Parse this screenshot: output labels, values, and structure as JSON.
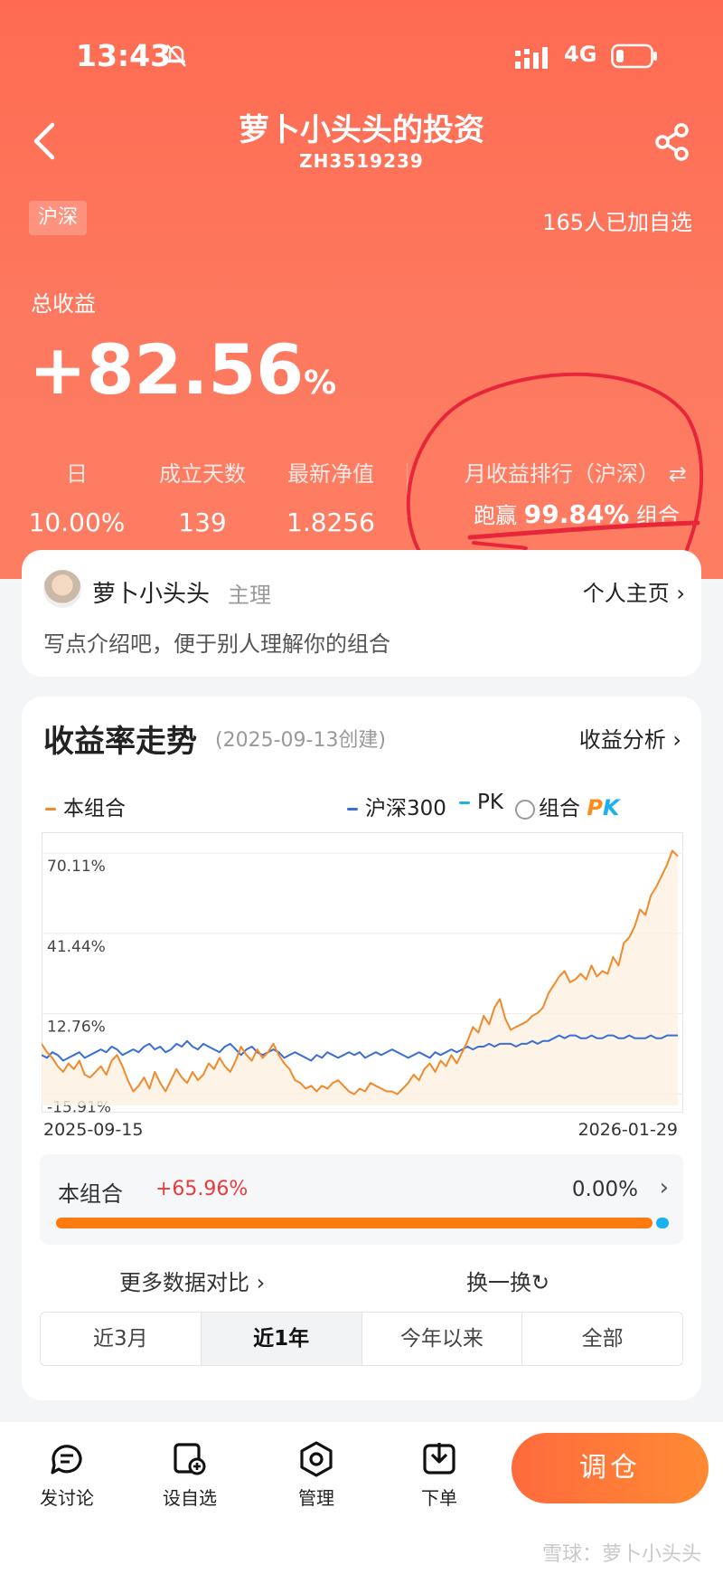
{
  "status_bar": {
    "time": "13:43",
    "network": "4G"
  },
  "header": {
    "title": "萝卜小头头的投资",
    "code": "ZH3519239",
    "market_tag": "沪深",
    "watch_count": "165人已加自选"
  },
  "summary": {
    "total_label": "总收益",
    "total_value": "+82.56",
    "total_unit": "%",
    "stats": [
      {
        "label": "日",
        "value": "10.00%"
      },
      {
        "label": "成立天数",
        "value": "139"
      },
      {
        "label": "最新净值",
        "value": "1.8256"
      }
    ],
    "rank_label": "月收益排行（沪深）",
    "rank_prefix": "跑赢",
    "rank_value": "99.84%",
    "rank_suffix": "组合"
  },
  "manager": {
    "name": "萝卜小头头",
    "role": "主理",
    "profile_link": "个人主页 ›",
    "description": "写点介绍吧，便于别人理解你的组合"
  },
  "chart_section": {
    "title": "收益率走势",
    "created": "(2025-09-13创建)",
    "analysis_link": "收益分析 ›",
    "legend": {
      "portfolio": "本组合",
      "index": "沪深300",
      "pk": "PK",
      "pk_toggle": "组合",
      "pk_badge_p": "P",
      "pk_badge_k": "K"
    },
    "compare": {
      "label": "本组合",
      "value": "+65.96%",
      "right_value": "0.00%",
      "chevron": "›"
    },
    "more_link": "更多数据对比 ›",
    "swap_link": "换一换",
    "swap_icon": "↻",
    "range_tabs": [
      "近3月",
      "近1年",
      "今年以来",
      "全部"
    ],
    "active_tab": 1
  },
  "chart_data": {
    "type": "line",
    "y_tick_labels": [
      "70.11%",
      "41.44%",
      "12.76%",
      "-15.91%"
    ],
    "y_ticks": [
      70.11,
      41.44,
      12.76,
      -15.91
    ],
    "ylim": [
      -20,
      75
    ],
    "x_start_label": "2025-09-15",
    "x_end_label": "2026-01-29",
    "colors": {
      "portfolio": "#f08a2c",
      "index": "#3b6fd4",
      "fill": "#fdf0e0"
    },
    "series": [
      {
        "name": "本组合",
        "values": [
          2,
          -1,
          -3,
          -6,
          -8,
          -5,
          -7,
          -4,
          -9,
          -10,
          -8,
          -6,
          -9,
          -4,
          -2,
          -6,
          -11,
          -15,
          -13,
          -10,
          -14,
          -8,
          -12,
          -15,
          -11,
          -7,
          -10,
          -12,
          -8,
          -11,
          -9,
          -5,
          -7,
          -3,
          -6,
          -8,
          -4,
          1,
          -2,
          -4,
          0,
          -3,
          -1,
          2,
          -2,
          -5,
          -7,
          -11,
          -12,
          -14,
          -13,
          -15,
          -13,
          -14,
          -12,
          -11,
          -13,
          -15,
          -16,
          -14,
          -15,
          -12,
          -13,
          -14,
          -15,
          -15,
          -16,
          -14,
          -12,
          -9,
          -11,
          -7,
          -5,
          -8,
          -4,
          -6,
          -2,
          -5,
          -1,
          3,
          8,
          6,
          12,
          9,
          15,
          18,
          11,
          7,
          8,
          9,
          10,
          12,
          13,
          15,
          20,
          23,
          26,
          28,
          24,
          25,
          27,
          25,
          30,
          26,
          28,
          27,
          33,
          30,
          38,
          40,
          44,
          50,
          48,
          55,
          58,
          62,
          66,
          71,
          69
        ]
      },
      {
        "name": "沪深300",
        "values": [
          -2,
          -3,
          -1,
          -2,
          -4,
          -3,
          -2,
          -1,
          -3,
          -2,
          -1,
          0,
          -1,
          1,
          0,
          -2,
          -1,
          0,
          -1,
          1,
          2,
          0,
          1,
          -1,
          0,
          2,
          1,
          3,
          1,
          0,
          2,
          1,
          0,
          -1,
          1,
          2,
          0,
          -2,
          0,
          1,
          -1,
          -2,
          -1,
          0,
          -1,
          -3,
          -2,
          -1,
          -2,
          -3,
          -4,
          -2,
          -3,
          -1,
          -2,
          -3,
          -2,
          -1,
          -2,
          -1,
          -3,
          -2,
          -1,
          -2,
          -1,
          0,
          -1,
          -2,
          -3,
          -2,
          -1,
          -2,
          -3,
          -1,
          -2,
          -1,
          0,
          -1,
          0,
          1,
          0,
          1,
          1,
          2,
          1,
          2,
          2,
          2,
          1,
          2,
          2,
          3,
          2,
          3,
          3,
          4,
          5,
          4,
          5,
          5,
          4,
          4,
          5,
          4,
          4,
          5,
          5,
          4,
          4,
          5,
          4,
          4,
          4,
          5,
          4,
          4,
          5,
          5,
          5
        ]
      }
    ]
  }
}
